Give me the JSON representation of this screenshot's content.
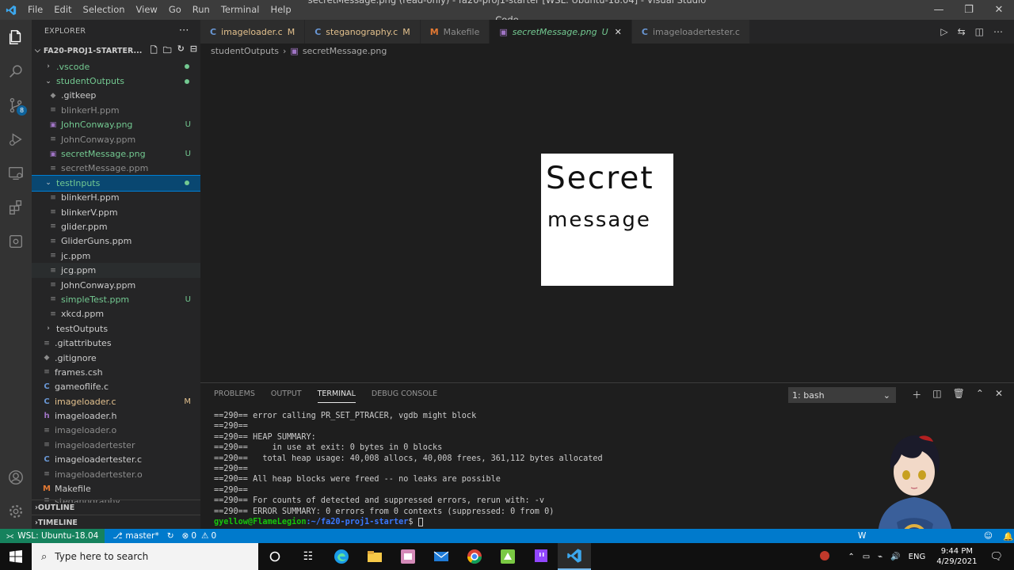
{
  "titlebar": {
    "menu": [
      "File",
      "Edit",
      "Selection",
      "View",
      "Go",
      "Run",
      "Terminal",
      "Help"
    ],
    "title": "secretMessage.png (read-only) - fa20-proj1-starter [WSL: Ubuntu-18.04] - Visual Studio Code"
  },
  "explorer": {
    "header": "EXPLORER",
    "project": "FA20-PROJ1-STARTER...",
    "items": [
      {
        "label": ".vscode"
      },
      {
        "label": "studentOutputs"
      },
      {
        "label": ".gitkeep"
      },
      {
        "label": "blinkerH.ppm"
      },
      {
        "label": "JohnConway.png",
        "status": "U"
      },
      {
        "label": "JohnConway.ppm"
      },
      {
        "label": "secretMessage.png",
        "status": "U"
      },
      {
        "label": "secretMessage.ppm"
      },
      {
        "label": "testInputs"
      },
      {
        "label": "blinkerH.ppm"
      },
      {
        "label": "blinkerV.ppm"
      },
      {
        "label": "glider.ppm"
      },
      {
        "label": "GliderGuns.ppm"
      },
      {
        "label": "jc.ppm"
      },
      {
        "label": "jcg.ppm"
      },
      {
        "label": "JohnConway.ppm"
      },
      {
        "label": "simpleTest.ppm",
        "status": "U"
      },
      {
        "label": "xkcd.ppm"
      },
      {
        "label": "testOutputs"
      },
      {
        "label": ".gitattributes"
      },
      {
        "label": ".gitignore"
      },
      {
        "label": "frames.csh"
      },
      {
        "label": "gameoflife.c"
      },
      {
        "label": "imageloader.c",
        "status": "M"
      },
      {
        "label": "imageloader.h"
      },
      {
        "label": "imageloader.o"
      },
      {
        "label": "imageloadertester"
      },
      {
        "label": "imageloadertester.c"
      },
      {
        "label": "imageloadertester.o"
      },
      {
        "label": "Makefile"
      },
      {
        "label": "steganography"
      }
    ],
    "outline": "OUTLINE",
    "timeline": "TIMELINE"
  },
  "tabs": [
    {
      "icon": "C",
      "label": "imageloader.c",
      "status": "M"
    },
    {
      "icon": "C",
      "label": "steganography.c",
      "status": "M"
    },
    {
      "icon": "M",
      "label": "Makefile",
      "status": ""
    },
    {
      "icon": "img",
      "label": "secretMessage.png",
      "status": "U"
    },
    {
      "icon": "C",
      "label": "imageloadertester.c",
      "status": ""
    }
  ],
  "breadcrumb": [
    "studentOutputs",
    "secretMessage.png"
  ],
  "image": {
    "line1": "Secret",
    "line2": "message"
  },
  "panel": {
    "tabs": [
      "PROBLEMS",
      "OUTPUT",
      "TERMINAL",
      "DEBUG CONSOLE"
    ],
    "terminal_select": "1: bash"
  },
  "terminal": {
    "lines": [
      "==290== error calling PR_SET_PTRACER, vgdb might block",
      "==290==",
      "==290== HEAP SUMMARY:",
      "==290==     in use at exit: 0 bytes in 0 blocks",
      "==290==   total heap usage: 40,008 allocs, 40,008 frees, 361,112 bytes allocated",
      "==290==",
      "==290== All heap blocks were freed -- no leaks are possible",
      "==290==",
      "==290== For counts of detected and suppressed errors, rerun with: -v",
      "==290== ERROR SUMMARY: 0 errors from 0 contexts (suppressed: 0 from 0)"
    ],
    "prompt_user": "gyellow@FlameLegion",
    "prompt_path": ":~/fa20-proj1-starter",
    "prompt_end": "$ "
  },
  "statusbar": {
    "remote": "WSL: Ubuntu-18.04",
    "branch": "master*",
    "problems": "0",
    "warnings": "0",
    "right_text": "W"
  },
  "taskbar": {
    "search_placeholder": "Type here to search",
    "lang": "ENG",
    "time": "9:44 PM",
    "date": "4/29/2021"
  },
  "colors": {
    "accent": "#007acc",
    "remote": "#16825d",
    "untracked": "#73c991",
    "modified": "#e2c08d"
  }
}
